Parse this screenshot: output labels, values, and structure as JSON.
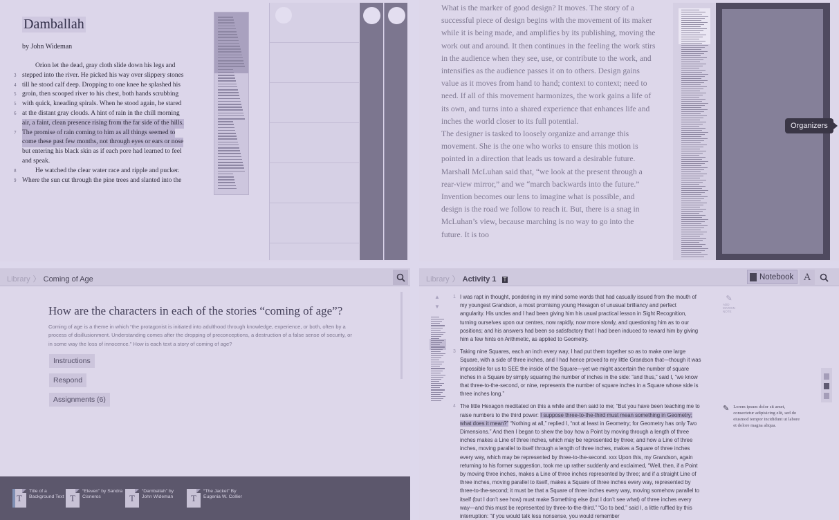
{
  "top_left": {
    "title": "Damballah",
    "byline": "by John Wideman",
    "lines": [
      {
        "num": "",
        "text": "        Orion let the dead, gray cloth slide down his legs and",
        "hl": false
      },
      {
        "num": "3",
        "text": "stepped into the river. He picked his way over slippery stones",
        "hl": false
      },
      {
        "num": "4",
        "text": "till he stood calf deep. Dropping to one knee he splashed his",
        "hl": false
      },
      {
        "num": "5",
        "text": "groin, then scooped river to his chest, both hands scrubbing",
        "hl": false
      },
      {
        "num": "5",
        "text": "with quick, kneading spirals. When he stood again, he stared",
        "hl": false
      },
      {
        "num": "6",
        "text": "at the distant gray clouds. A hint of rain in the chill morning",
        "hl": false
      },
      {
        "num": "",
        "text": "air, a faint, clean presence rising from the far side of the hills.",
        "hl": true
      },
      {
        "num": "7",
        "text": "The promise of rain coming to him as all things seemed to",
        "hl": true
      },
      {
        "num": "",
        "text": "come these past few months, not through eyes or ears or nose",
        "hl": true
      },
      {
        "num": "",
        "text": "but entering his black skin as if each pore had learned to feel",
        "hl": false
      },
      {
        "num": "",
        "text": "and speak.",
        "hl": false
      },
      {
        "num": "8",
        "text": "        He watched the clear water race and ripple and pucker.",
        "hl": false
      },
      {
        "num": "9",
        "text": "Where the sun cut through the pine trees and slanted into the",
        "hl": false
      }
    ]
  },
  "top_right": {
    "paragraphs": [
      "What is the marker of good design? It moves. The story of a successful piece of design begins with the movement of its maker while it is being made, and amplifies by its publishing, moving the work out and around. It then continues in the feeling the work stirs in the audience when they see, use, or contribute to the work, and intensifies as the audience passes it on to others. Design gains value as it moves from hand to hand; context to context; need to need. If all of this movement harmonizes, the work gains a life of its own, and turns into a shared experience that enhances life and inches the world closer to its full potential.",
      "The designer is tasked to loosely organize and arrange this movement. She is the one who works to ensure this motion is pointed in a direction that leads us toward a desirable future. Marshall McLuhan said that, “we look at the present through a rear-view mirror,” and we “march backwards into the future.” Invention becomes our lens to imagine what is possible, and design is the road we follow to reach it. But, there is a snag in McLuhan’s view, because marching is no way to go into the future. It is too"
    ],
    "tooltip": "Organizers"
  },
  "bottom_left": {
    "breadcrumb": {
      "root": "Library",
      "current": "Coming of Age"
    },
    "question": "How are the characters in each of the stories “coming of age”?",
    "description": "Coming of age is a theme in which “the protagonist is initiated into adulthood through knowledge, experience, or both, often by a process of disillusionment. Understanding comes after the dropping of preconceptions, a destruction of a false sense of security, or in some way the loss of innocence.”  How is each text a story of  coming of age?",
    "buttons": {
      "instructions": "Instructions",
      "respond": "Respond",
      "assignments": "Assignments (6)"
    },
    "tray": [
      {
        "glyph": "T",
        "caption": "Title of a Background Text"
      },
      {
        "glyph": "T",
        "caption": "“Eleven” by Sandra Cisneros"
      },
      {
        "glyph": "T",
        "caption": "“Damballah” by John Wideman"
      },
      {
        "glyph": "T",
        "caption": "“The Jacket” By Eugenia W. Collier"
      }
    ]
  },
  "bottom_right": {
    "breadcrumb": {
      "root": "Library",
      "current": "Activity 1",
      "tag": "T"
    },
    "notebook_label": "Notebook",
    "font_icon": "A",
    "add_note_label": "ADD MARGIN NOTE",
    "paragraphs": [
      {
        "num": "1",
        "pre": "I was rapt in thought, pondering in my mind some words that had casually issued from the mouth of my youngest Grandson, a most promising young Hexagon of unusual brilliancy and perfect angularity. His uncles and I had been giving him his usual practical lesson in Sight Recognition, turning ourselves upon our centres, now rapidly, now more slowly, and questioning him as to our positions; and his answers had been so satisfactory that I had been induced to reward him by giving him a few hints on Arithmetic, as applied to Geometry.",
        "hl": "",
        "post": ""
      },
      {
        "num": "3",
        "pre": "Taking nine Squares, each an inch every way, I had put them together so as to make one large Square, with a side of three inches, and I had hence proved to my little Grandson that—though it was impossible for us to SEE the inside of the Square—yet we might ascertain the number of square inches in a Square by simply squaring the number of inches in the side: “and thus,” said I, “we know that three-to-the-second, or nine, represents the number of square inches in a Square whose side is three inches long.”",
        "hl": "",
        "post": ""
      },
      {
        "num": "4",
        "pre": "The little Hexagon meditated on this a while and then said to me; “But you have been teaching me to raise numbers to the third power: ",
        "hl": "I suppose three-to-the-third must mean something in Geometry; what does it mean?”",
        "post": " “Nothing at all,” replied I, “not at least in Geometry; for Geometry has only Two Dimensions.” And then I began to shew the boy how a Point by moving through a length of three inches makes a Line of three inches, which may be represented by three; and how a Line of three inches, moving parallel to itself through a length of three inches, makes a Square of three inches every way, which may be represented by three-to-the-second. xxx Upon this, my Grandson, again returning to his former suggestion, took me up rather suddenly and exclaimed, “Well, then, if a Point by moving three inches, makes a Line of three inches represented by three; and if a straight Line of three inches, moving parallel to itself, makes a Square of three inches every way, represented by three-to-the-second; it must be that a Square of three inches every way, moving somehow parallel to itself (but I don’t see how) must make Something else (but I don’t see what) of three inches every way—and this must be represented by three-to-the-third.” “Go to bed,” said I, a little ruffled by this interruption: “if you would talk less nonsense, you would remember"
      }
    ],
    "margin_note": "Lorem ipsum dolor sit amet, consectetur adipisicing elit, sed do eiusmod tempor incididunt ut labore et dolore magna aliqua."
  }
}
